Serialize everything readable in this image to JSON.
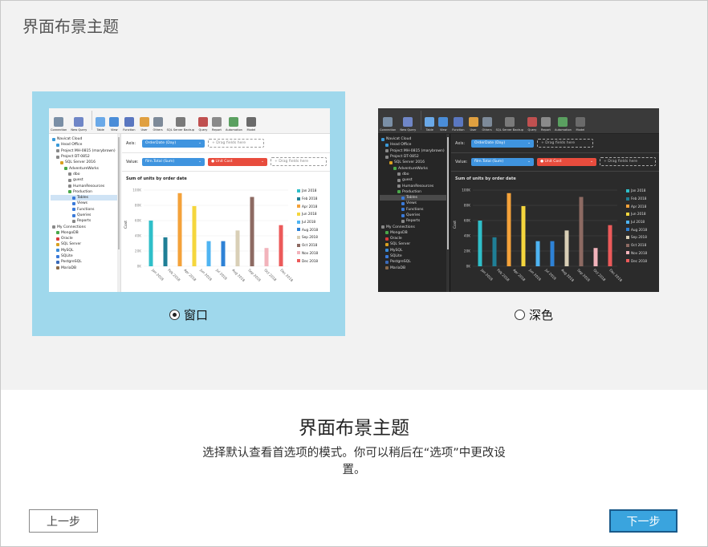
{
  "window": {
    "title": "界面布景主题"
  },
  "themes": [
    {
      "key": "light",
      "label": "窗口",
      "selected": true
    },
    {
      "key": "dark",
      "label": "深色",
      "selected": false
    }
  ],
  "colors": {
    "selected_card": "#9fd8ec",
    "next_button": "#3aa4de",
    "pill_blue": "#3f94df",
    "pill_red": "#e84c3d"
  },
  "preview": {
    "toolbar": [
      {
        "label": "Connection",
        "icon": "connection-icon",
        "color": "#7a8fa6"
      },
      {
        "label": "New Query",
        "icon": "new-query-icon",
        "color": "#6f86c7"
      },
      {
        "label": "Table",
        "icon": "table-icon",
        "color": "#3f7fd1",
        "selected": true
      },
      {
        "label": "View",
        "icon": "view-icon",
        "color": "#4a8dd8"
      },
      {
        "label": "Function",
        "icon": "function-icon",
        "color": "#5a77c0"
      },
      {
        "label": "User",
        "icon": "user-icon",
        "color": "#e0a040"
      },
      {
        "label": "Others",
        "icon": "others-icon",
        "color": "#7d8a99"
      },
      {
        "label": "SQL Server Backup",
        "icon": "backup-icon",
        "color": "#7a7a7a"
      },
      {
        "label": "Query",
        "icon": "query-icon",
        "color": "#c05050"
      },
      {
        "label": "Report",
        "icon": "report-icon",
        "color": "#8a8a8a"
      },
      {
        "label": "Automation",
        "icon": "automation-icon",
        "color": "#5aa060"
      },
      {
        "label": "Model",
        "icon": "model-icon",
        "color": "#6a6a6a"
      }
    ],
    "nav": [
      {
        "label": "Navicat Cloud",
        "indent": 0,
        "color": "#3a9ad9"
      },
      {
        "label": "Head Office",
        "indent": 1,
        "color": "#3a9ad9"
      },
      {
        "label": "Project MH-0815 (marybrown)",
        "indent": 1,
        "color": "#888"
      },
      {
        "label": "Project DT-0852",
        "indent": 1,
        "color": "#888"
      },
      {
        "label": "SQL Server 2016",
        "indent": 2,
        "color": "#d9a020"
      },
      {
        "label": "AdventureWorks",
        "indent": 3,
        "color": "#4aa84a"
      },
      {
        "label": "dbo",
        "indent": 4,
        "color": "#888"
      },
      {
        "label": "guest",
        "indent": 4,
        "color": "#888"
      },
      {
        "label": "HumanResources",
        "indent": 4,
        "color": "#888"
      },
      {
        "label": "Production",
        "indent": 4,
        "color": "#4aa84a"
      },
      {
        "label": "Tables",
        "indent": 5,
        "color": "#3a7ad9",
        "highlight": true
      },
      {
        "label": "Views",
        "indent": 5,
        "color": "#3a7ad9"
      },
      {
        "label": "Functions",
        "indent": 5,
        "color": "#3a7ad9"
      },
      {
        "label": "Queries",
        "indent": 5,
        "color": "#3a7ad9"
      },
      {
        "label": "Reports",
        "indent": 5,
        "color": "#888"
      },
      {
        "label": "My Connections",
        "indent": 0,
        "color": "#888"
      },
      {
        "label": "MongoDB",
        "indent": 1,
        "color": "#4aa84a"
      },
      {
        "label": "Oracle",
        "indent": 1,
        "color": "#d93a3a"
      },
      {
        "label": "SQL Server",
        "indent": 1,
        "color": "#d9a020"
      },
      {
        "label": "MySQL",
        "indent": 1,
        "color": "#3a8ad9"
      },
      {
        "label": "SQLite",
        "indent": 1,
        "color": "#3a7ad9"
      },
      {
        "label": "PostgreSQL",
        "indent": 1,
        "color": "#3a6ab9"
      },
      {
        "label": "MariaDB",
        "indent": 1,
        "color": "#8a6a4a"
      }
    ],
    "axis_label": "Axis:",
    "axis_field": "OrderDate (Day)",
    "value_label": "Value:",
    "value_field_1": "film.Total (Sum)",
    "value_field_2": "Unit Cost",
    "drag_hint": "Drag fields here",
    "chart_title": "Sum of units by order date"
  },
  "chart_data": {
    "type": "bar",
    "ylabel": "Cost",
    "ylim": [
      0,
      100
    ],
    "yticks": [
      "0K",
      "20K",
      "40K",
      "60K",
      "80K",
      "100K"
    ],
    "tick_labels": [
      "Jan 2018",
      "Feb 2018",
      "Apr 2018",
      "Jun 2018",
      "Jul 2018",
      "Aug 2018",
      "Sep 2018",
      "Oct 2018",
      "Dec 2018"
    ],
    "series": [
      {
        "name": "Jan 2018",
        "value": 60,
        "color": "#2fbfc9"
      },
      {
        "name": "Feb 2018",
        "value": 38,
        "color": "#1f7f96"
      },
      {
        "name": "Apr 2018",
        "value": 96,
        "color": "#f4a23a"
      },
      {
        "name": "Jun 2018",
        "value": 79,
        "color": "#f5d63d"
      },
      {
        "name": "Jul 2018",
        "value": 33,
        "color": "#4fb4f2"
      },
      {
        "name": "Aug 2018",
        "value": 33,
        "color": "#2e82d6"
      },
      {
        "name": "Sep 2018",
        "value": 47,
        "color": "#d9cfb6"
      },
      {
        "name": "Oct 2018",
        "value": 91,
        "color": "#8d6a62"
      },
      {
        "name": "Nov 2018",
        "value": 24,
        "color": "#f2b3bb"
      },
      {
        "name": "Dec 2018",
        "value": 54,
        "color": "#ec5a5a"
      }
    ]
  },
  "content": {
    "title": "界面布景主题",
    "description": "选择默认查看首选项的模式。你可以稍后在“选项”中更改设置。"
  },
  "buttons": {
    "prev": "上一步",
    "next": "下一步"
  }
}
